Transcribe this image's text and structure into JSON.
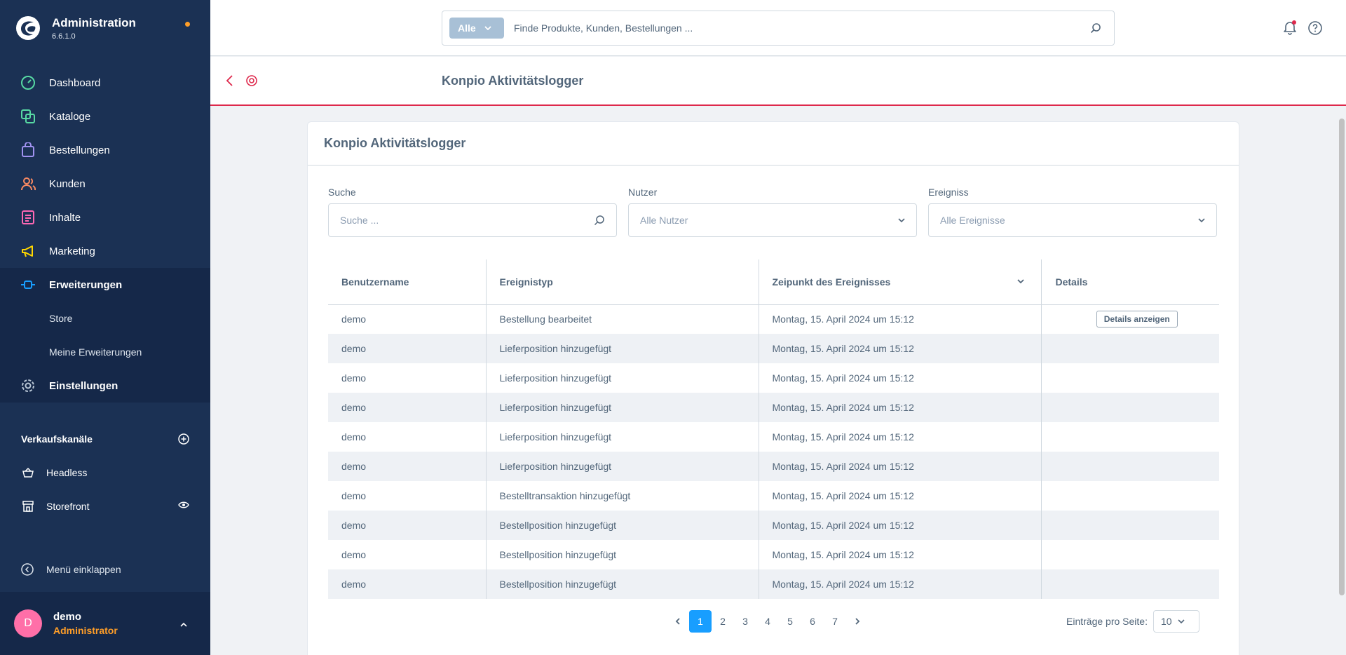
{
  "app": {
    "title": "Administration",
    "version": "6.6.1.0"
  },
  "nav": [
    {
      "label": "Dashboard",
      "icon": "dashboard-icon",
      "color": "#57d9a3"
    },
    {
      "label": "Kataloge",
      "icon": "catalog-icon",
      "color": "#57d9a3"
    },
    {
      "label": "Bestellungen",
      "icon": "orders-icon",
      "color": "#a092f0"
    },
    {
      "label": "Kunden",
      "icon": "customers-icon",
      "color": "#f88962"
    },
    {
      "label": "Inhalte",
      "icon": "content-icon",
      "color": "#ff68b4"
    },
    {
      "label": "Marketing",
      "icon": "marketing-icon",
      "color": "#ffd700"
    },
    {
      "label": "Erweiterungen",
      "icon": "extensions-icon",
      "color": "#189eff"
    }
  ],
  "nav_sub": [
    "Store",
    "Meine Erweiterungen"
  ],
  "nav_settings": "Einstellungen",
  "sales_channels": {
    "title": "Verkaufskanäle",
    "items": [
      "Headless",
      "Storefront"
    ]
  },
  "collapse_label": "Menü einklappen",
  "user": {
    "initial": "D",
    "name": "demo",
    "role": "Administrator"
  },
  "search": {
    "type": "Alle",
    "placeholder": "Finde Produkte, Kunden, Bestellungen ..."
  },
  "page_title": "Konpio Aktivitätslogger",
  "card_title": "Konpio Aktivitätslogger",
  "filters": [
    {
      "label": "Suche",
      "placeholder": "Suche ..."
    },
    {
      "label": "Nutzer",
      "placeholder": "Alle Nutzer"
    },
    {
      "label": "Ereigniss",
      "placeholder": "Alle Ereignisse"
    }
  ],
  "table": {
    "columns": [
      "Benutzername",
      "Ereignistyp",
      "Zeipunkt des Ereignisses",
      "Details"
    ],
    "details_button": "Details anzeigen",
    "rows": [
      [
        "demo",
        "Bestellung bearbeitet",
        "Montag, 15. April 2024 um 15:12"
      ],
      [
        "demo",
        "Lieferposition hinzugefügt",
        "Montag, 15. April 2024 um 15:12"
      ],
      [
        "demo",
        "Lieferposition hinzugefügt",
        "Montag, 15. April 2024 um 15:12"
      ],
      [
        "demo",
        "Lieferposition hinzugefügt",
        "Montag, 15. April 2024 um 15:12"
      ],
      [
        "demo",
        "Lieferposition hinzugefügt",
        "Montag, 15. April 2024 um 15:12"
      ],
      [
        "demo",
        "Lieferposition hinzugefügt",
        "Montag, 15. April 2024 um 15:12"
      ],
      [
        "demo",
        "Bestelltransaktion hinzugefügt",
        "Montag, 15. April 2024 um 15:12"
      ],
      [
        "demo",
        "Bestellposition hinzugefügt",
        "Montag, 15. April 2024 um 15:12"
      ],
      [
        "demo",
        "Bestellposition hinzugefügt",
        "Montag, 15. April 2024 um 15:12"
      ],
      [
        "demo",
        "Bestellposition hinzugefügt",
        "Montag, 15. April 2024 um 15:12"
      ]
    ]
  },
  "pagination": {
    "pages": [
      "1",
      "2",
      "3",
      "4",
      "5",
      "6",
      "7"
    ],
    "current": "1"
  },
  "per_page": {
    "label": "Einträge pro Seite:",
    "value": "10"
  },
  "colors": {
    "sidebar": "#1b3154",
    "accent": "#189eff",
    "smartbar_border": "#de294c",
    "role": "#ff9e28"
  }
}
